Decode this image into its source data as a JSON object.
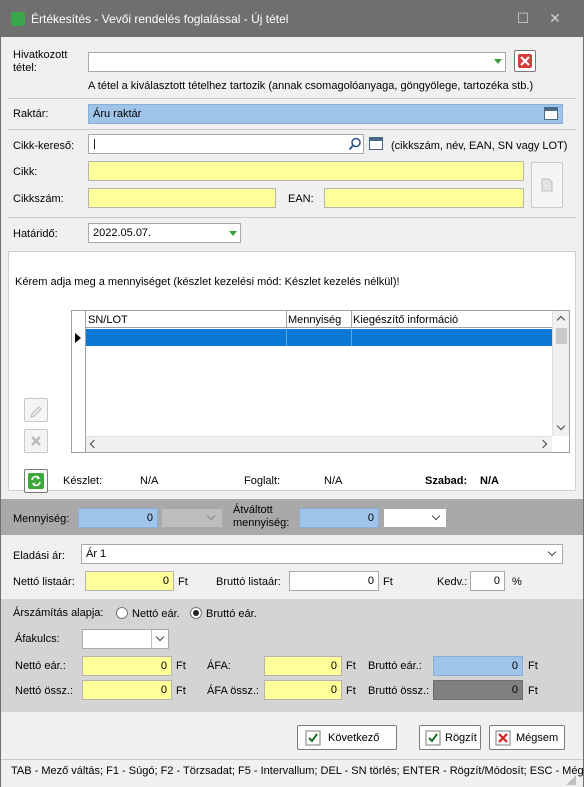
{
  "window": {
    "title": "Értékesítés - Vevői rendelés foglalással - Új tétel"
  },
  "ref_item": {
    "label_1": "Hivatkozott",
    "label_2": "tétel:",
    "value": "",
    "hint": "A tétel a kiválasztott tételhez tartozik (annak csomagolóanyaga, göngyölege, tartozéka stb.)"
  },
  "warehouse": {
    "label": "Raktár:",
    "value": "Áru raktár"
  },
  "item_search": {
    "label": "Cikk-kereső:",
    "value": "",
    "hint": "(cikkszám, név, EAN, SN vagy LOT)"
  },
  "item": {
    "label": "Cikk:",
    "value": ""
  },
  "item_no": {
    "label": "Cikkszám:",
    "value": ""
  },
  "ean": {
    "label": "EAN:",
    "value": ""
  },
  "deadline": {
    "label": "Határidő:",
    "value": "2022.05.07."
  },
  "message": "Kérem adja meg a mennyiséget (készlet kezelési mód: Készlet kezelés nélkül)!",
  "grid": {
    "columns": [
      "SN/LOT",
      "Mennyiség",
      "Kiegészítő információ"
    ]
  },
  "stock": {
    "stock_label": "Készlet:",
    "stock_value": "N/A",
    "reserved_label": "Foglalt:",
    "reserved_value": "N/A",
    "free_label": "Szabad:",
    "free_value": "N/A"
  },
  "quantity": {
    "label": "Mennyiség:",
    "value": "0",
    "unit": "",
    "conv_label_1": "Átváltott",
    "conv_label_2": "mennyiség:",
    "conv_value": "0",
    "conv_unit": ""
  },
  "price": {
    "sales_price_label": "Eladási ár:",
    "sales_price_value": "Ár 1",
    "net_list_label": "Nettó listaár:",
    "net_list_value": "0",
    "net_list_cur": "Ft",
    "gross_list_label": "Bruttó listaár:",
    "gross_list_value": "0",
    "gross_list_cur": "Ft",
    "discount_label": "Kedv.:",
    "discount_value": "0",
    "discount_unit": "%"
  },
  "pricing": {
    "basis_label": "Árszámítás alapja:",
    "net_option": "Nettó eár.",
    "gross_option": "Bruttó eár.",
    "selected": "Bruttó eár.",
    "vat_label": "Áfakulcs:",
    "vat_value": "",
    "net_unit_label": "Nettó eár.:",
    "net_unit_value": "0",
    "net_unit_cur": "Ft",
    "vat_amount_label": "ÁFA:",
    "vat_amount_value": "0",
    "vat_amount_cur": "Ft",
    "gross_unit_label": "Bruttó eár.:",
    "gross_unit_value": "0",
    "gross_unit_cur": "Ft",
    "net_total_label": "Nettó össz.:",
    "net_total_value": "0",
    "net_total_cur": "Ft",
    "vat_total_label": "ÁFA össz.:",
    "vat_total_value": "0",
    "vat_total_cur": "Ft",
    "gross_total_label": "Bruttó össz.:",
    "gross_total_value": "0",
    "gross_total_cur": "Ft"
  },
  "buttons": {
    "next": "Következő",
    "save": "Rögzít",
    "cancel": "Mégsem"
  },
  "statusbar": "TAB - Mező váltás; F1 - Súgó; F2 - Törzsadat; F5 - Intervallum; DEL - SN törlés; ENTER - Rögzít/Módosít; ESC - Mégsem",
  "colors": {
    "required_yellow": "#ffff99",
    "readonly_blue": "#9ec4e9",
    "band_gray": "#d4d4d4",
    "titlebar": "#6f6f6f"
  }
}
